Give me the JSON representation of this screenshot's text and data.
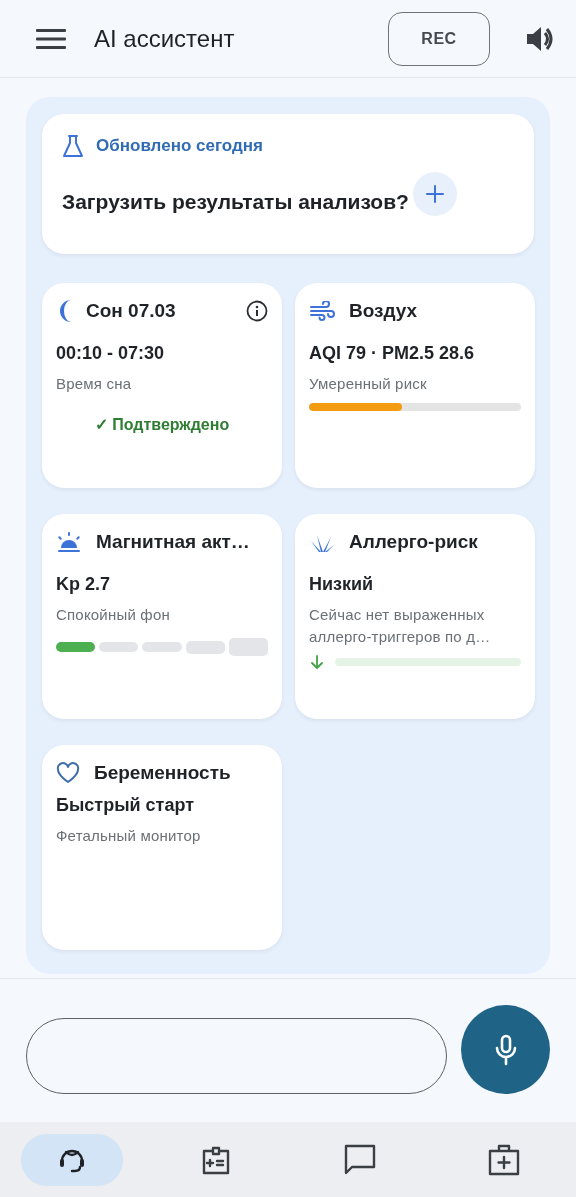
{
  "header": {
    "title": "AI ассистент",
    "rec_button": "REC"
  },
  "upload_card": {
    "tag": "Обновлено сегодня",
    "question": "Загрузить результаты анализов?"
  },
  "cards": [
    {
      "kind": "sleep",
      "title": "Сон 07.03",
      "value": "00:10 - 07:30",
      "caption": "Время сна",
      "status": "✓ Подтверждено"
    },
    {
      "kind": "air",
      "title": "Воздух",
      "value": "AQI 79 · PM2.5 28.6",
      "caption": "Умеренный риск",
      "level": 0.44
    },
    {
      "kind": "magnetic",
      "title": "Магнитная акт…",
      "value": "Kp 2.7",
      "caption": "Спокойный фон",
      "level": 0.2
    },
    {
      "kind": "allergy",
      "title": "Аллерго-риск",
      "value": "Низкий",
      "caption": "Сейчас нет выраженных аллерго-триггеров по д…"
    },
    {
      "kind": "pregnancy",
      "title": "Беременность",
      "value": "Быстрый старт",
      "caption": "Фетальный монитор"
    }
  ],
  "nav": [
    {
      "kind": "support",
      "selected": true
    },
    {
      "kind": "card",
      "selected": false
    },
    {
      "kind": "chat",
      "selected": false
    },
    {
      "kind": "kit",
      "selected": false
    }
  ]
}
